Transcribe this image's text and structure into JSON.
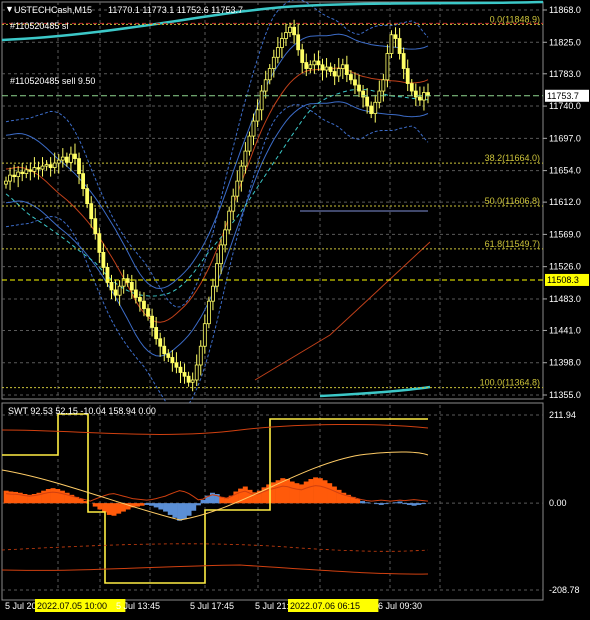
{
  "window": {
    "symbol_label": "USTECHCash,M15",
    "ohlc_label": "11770.1 11773.1 11752.6 11753.7",
    "order_label_1": "#110520485 sl",
    "order_label_2": "#110520485 sell 9.50",
    "current_price_tag": "11753.7",
    "level_tag": "11508.3"
  },
  "indicator": {
    "label": "SWT 92.53 52.15 -10.04 158.94 0.00"
  },
  "colors": {
    "background": "#000000",
    "grid": "#5a5a5a",
    "price_line": "#ffff66",
    "fib": "#ccc33a",
    "teal": "#3cc8c8",
    "blue_band": "#3c6cc8",
    "red_band": "#c0401a",
    "histogram_orange": "#ff5a0a",
    "histogram_blue": "#5b8fd6",
    "yellow_step": "#ffee44",
    "price_tag_bg": "#ffffff",
    "level_tag_bg": "#ffff00"
  },
  "chart_data": [
    {
      "type": "line",
      "subtype": "candlestick",
      "title": "USTECHCash,M15",
      "ylim": [
        11355.0,
        11868.0
      ],
      "y_ticks": [
        "11868.0",
        "11825.0",
        "11783.0",
        "11740.0",
        "11697.0",
        "11654.0",
        "11612.0",
        "11569.0",
        "11526.0",
        "11483.0",
        "11441.0",
        "11398.0",
        "11355.0"
      ],
      "x_ticks": [
        "5 Jul 2022",
        "2022.07.05 10:00",
        "5 Jul 13:45",
        "5 Jul 17:45",
        "5 Jul 21:45",
        "2022.07.06 06:15",
        "6 Jul 09:30"
      ],
      "series": [
        {
          "name": "USTECHCash",
          "values": [
            11640,
            11648,
            11646,
            11652,
            11650,
            11655,
            11653,
            11658,
            11656,
            11660,
            11662,
            11658,
            11664,
            11668,
            11672,
            11665,
            11676,
            11670,
            11650,
            11630,
            11610,
            11590,
            11570,
            11545,
            11525,
            11505,
            11495,
            11488,
            11500,
            11510,
            11505,
            11495,
            11485,
            11480,
            11470,
            11460,
            11445,
            11430,
            11420,
            11410,
            11405,
            11398,
            11392,
            11385,
            11380,
            11372,
            11375,
            11395,
            11420,
            11450,
            11480,
            11500,
            11530,
            11555,
            11575,
            11600,
            11620,
            11640,
            11660,
            11680,
            11700,
            11720,
            11735,
            11760,
            11775,
            11790,
            11805,
            11818,
            11830,
            11838,
            11845,
            11835,
            11815,
            11798,
            11790,
            11795,
            11800,
            11795,
            11788,
            11792,
            11786,
            11780,
            11790,
            11795,
            11782,
            11775,
            11768,
            11760,
            11752,
            11740,
            11730,
            11745,
            11760,
            11775,
            11810,
            11835,
            11830,
            11810,
            11790,
            11770,
            11760,
            11752,
            11748,
            11758,
            11753.7
          ]
        }
      ],
      "fibonacci_levels": [
        {
          "label": "0.0(11848.9)",
          "value": 11848.9
        },
        {
          "label": "38.2(11664.0)",
          "value": 11664.0
        },
        {
          "label": "50.0(11606.8)",
          "value": 11606.8
        },
        {
          "label": "61.8(11549.7)",
          "value": 11549.7
        },
        {
          "label": "100.0(11364.8)",
          "value": 11364.8
        }
      ],
      "horizontal_levels": [
        {
          "label": "11508.3",
          "value": 11508.3
        },
        {
          "label": "11753.7",
          "value": 11753.7
        }
      ],
      "grid": true
    },
    {
      "type": "bar",
      "title": "SWT 92.53 52.15 -10.04 158.94 0.00",
      "ylim": [
        -208.78,
        211.94
      ],
      "y_ticks": [
        "211.94",
        "0.00",
        "-208.78"
      ],
      "series": [
        {
          "name": "histogram",
          "values": [
            30,
            28,
            27,
            25,
            22,
            20,
            22,
            25,
            30,
            34,
            36,
            34,
            30,
            25,
            20,
            15,
            10,
            5,
            0,
            -8,
            -15,
            -22,
            -28,
            -30,
            -25,
            -20,
            -15,
            -10,
            -8,
            -6,
            -4,
            -6,
            -10,
            -15,
            -20,
            -28,
            -35,
            -42,
            -38,
            -30,
            -18,
            -5,
            8,
            18,
            25,
            22,
            15,
            12,
            18,
            28,
            35,
            40,
            32,
            26,
            30,
            38,
            45,
            50,
            55,
            60,
            58,
            52,
            48,
            45,
            52,
            58,
            62,
            60,
            55,
            48,
            40,
            32,
            25,
            20,
            15,
            10,
            5,
            2,
            0,
            -2,
            -4,
            -2,
            0,
            2,
            4,
            -2,
            -4,
            -6,
            -4,
            -2,
            0
          ]
        }
      ],
      "grid": true
    }
  ]
}
